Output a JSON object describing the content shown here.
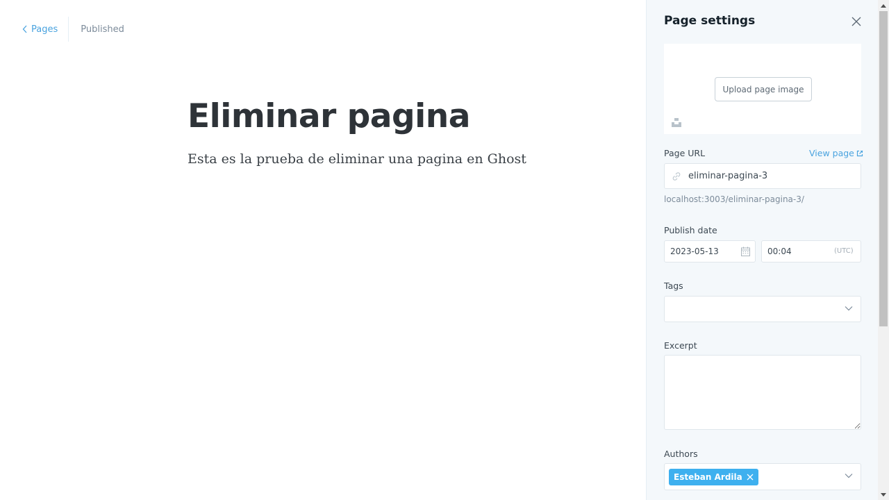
{
  "editor": {
    "back_label": "Pages",
    "status": "Published",
    "title": "Eliminar pagina",
    "body": "Esta es la prueba de eliminar una pagina en Ghost"
  },
  "settings": {
    "title": "Page settings",
    "upload_label": "Upload page image",
    "url_label": "Page URL",
    "view_page": "View page",
    "url_value": "eliminar-pagina-3",
    "url_hint": "localhost:3003/eliminar-pagina-3/",
    "publish_label": "Publish date",
    "date_value": "2023-05-13",
    "time_value": "00:04",
    "timezone": "(UTC)",
    "tags_label": "Tags",
    "excerpt_label": "Excerpt",
    "excerpt_value": "",
    "authors_label": "Authors",
    "authors": [
      "Esteban Ardila"
    ]
  },
  "icons": {
    "back": "chevron-left-icon",
    "close": "close-icon",
    "unsplash": "unsplash-icon",
    "external": "external-link-icon",
    "link": "link-icon",
    "calendar": "calendar-icon",
    "dropdown": "chevron-down-icon",
    "remove": "close-icon"
  },
  "colors": {
    "accent": "#4aa3df",
    "token": "#3eb0ef",
    "panel_bg": "#f4f8fb"
  }
}
